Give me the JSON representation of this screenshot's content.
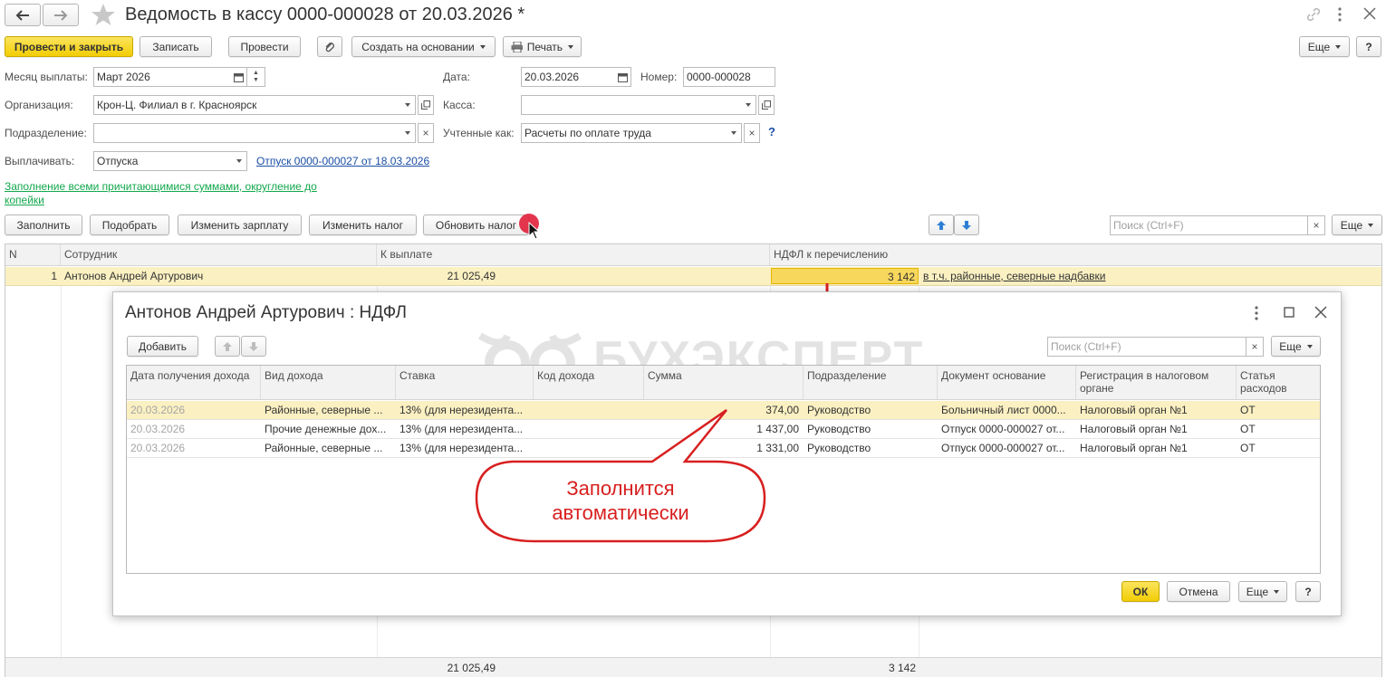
{
  "window": {
    "title": "Ведомость в кассу 0000-000028 от 20.03.2026 *",
    "back_icon": "arrow-left-icon",
    "forward_icon": "arrow-right-icon",
    "favorite_icon": "star-icon"
  },
  "toolbar": {
    "post_close": "Провести и закрыть",
    "save": "Записать",
    "post": "Провести",
    "create_based": "Создать на основании",
    "print": "Печать",
    "more": "Еще",
    "help": "?"
  },
  "form": {
    "month_label": "Месяц выплаты:",
    "month_value": "Март 2026",
    "date_label": "Дата:",
    "date_value": "20.03.2026",
    "number_label": "Номер:",
    "number_value": "0000-000028",
    "org_label": "Организация:",
    "org_value": "Крон-Ц. Филиал в г. Красноярск",
    "cash_label": "Касса:",
    "cash_value": "",
    "dept_label": "Подразделение:",
    "dept_value": "",
    "accounted_label": "Учтенные как:",
    "accounted_value": "Расчеты по оплате труда",
    "pay_label": "Выплачивать:",
    "pay_value": "Отпуска",
    "pay_link": "Отпуск 0000-000027 от 18.03.2026",
    "fill_hint_1": "Заполнение всеми причитающимися суммами, округление до",
    "fill_hint_2": "копейки"
  },
  "table_toolbar": {
    "fill": "Заполнить",
    "pick": "Подобрать",
    "change_salary": "Изменить зарплату",
    "change_tax": "Изменить налог",
    "update_tax": "Обновить налог",
    "search_placeholder": "Поиск (Ctrl+F)",
    "more": "Еще"
  },
  "table": {
    "headers": [
      "N",
      "Сотрудник",
      "К выплате",
      "НДФЛ к перечислению"
    ],
    "rows": [
      {
        "n": "1",
        "employee": "Антонов Андрей Артурович",
        "amount": "21 025,49",
        "ndfl": "3 142",
        "link": "в т.ч. районные, северные надбавки"
      }
    ],
    "totals": {
      "amount": "21 025,49",
      "ndfl": "3 142"
    }
  },
  "dialog": {
    "title": "Антонов Андрей Артурович : НДФЛ",
    "add": "Добавить",
    "search_placeholder": "Поиск (Ctrl+F)",
    "more": "Еще",
    "headers": [
      "Дата получения дохода",
      "Вид дохода",
      "Ставка",
      "Код дохода",
      "Сумма",
      "Подразделение",
      "Документ основание",
      "Регистрация в налоговом органе",
      "Статья расходов"
    ],
    "rows": [
      {
        "date": "20.03.2026",
        "kind": "Районные, северные ...",
        "rate": "13% (для нерезидента...",
        "code": "",
        "sum": "374,00",
        "dept": "Руководство",
        "doc": "Больничный лист 0000...",
        "reg": "Налоговый орган №1",
        "exp": "ОТ"
      },
      {
        "date": "20.03.2026",
        "kind": "Прочие денежные дох...",
        "rate": "13% (для нерезидента...",
        "code": "",
        "sum": "1 437,00",
        "dept": "Руководство",
        "doc": "Отпуск 0000-000027 от...",
        "reg": "Налоговый орган №1",
        "exp": "ОТ"
      },
      {
        "date": "20.03.2026",
        "kind": "Районные, северные ...",
        "rate": "13% (для нерезидента...",
        "code": "",
        "sum": "1 331,00",
        "dept": "Руководство",
        "doc": "Отпуск 0000-000027 от...",
        "reg": "Налоговый орган №1",
        "exp": "ОТ"
      }
    ],
    "ok": "ОК",
    "cancel": "Отмена",
    "help": "?"
  },
  "watermark": "БУХЭКСПЕРТ",
  "callout": {
    "line1": "Заполнится",
    "line2": "автоматически"
  },
  "colors": {
    "accent_yellow": "#f5d80e",
    "selected_row": "#fbf0c2",
    "link_blue": "#1a4ea3",
    "hint_green": "#12a84c",
    "callout_red": "#d81f1f"
  }
}
